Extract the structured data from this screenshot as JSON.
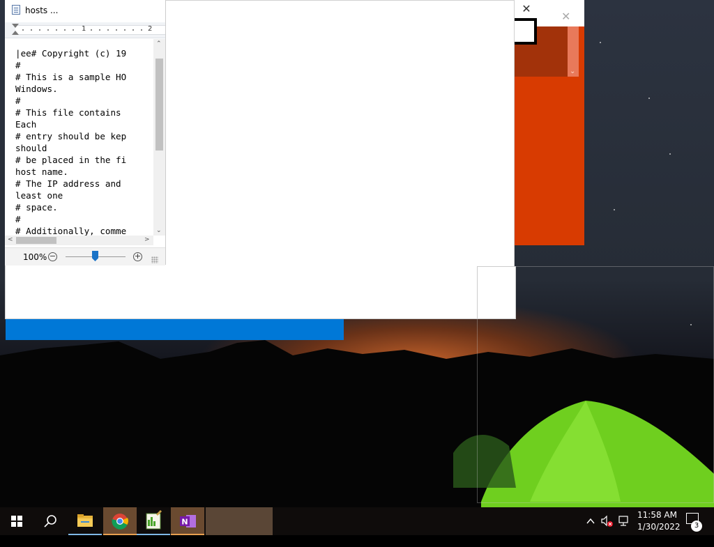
{
  "wordpad": {
    "title": "hosts ...",
    "ruler_marks": [
      "1",
      "2"
    ],
    "document_lines": [
      "|ee# Copyright (c) 19",
      "#",
      "# This is a sample HO",
      "Windows.",
      "#",
      "# This file contains",
      "Each",
      "# entry should be kep",
      "should",
      "# be placed in the fi",
      "host name.",
      "# The IP address and",
      "least one",
      "# space.",
      "#",
      "# Additionally, comme"
    ],
    "zoom_label": "100%",
    "zoom_out_symbol": "−",
    "zoom_in_symbol": "+",
    "zoom_percent": 100
  },
  "windows": {
    "close_symbol": "✕"
  },
  "taskbar": {
    "items": [
      {
        "name": "start-button",
        "icon": "windows-logo-icon"
      },
      {
        "name": "search-button",
        "icon": "search-icon"
      },
      {
        "name": "file-explorer",
        "icon": "folder-icon"
      },
      {
        "name": "google-chrome",
        "icon": "chrome-icon"
      },
      {
        "name": "notepad-plus",
        "icon": "notepad-icon"
      },
      {
        "name": "onenote",
        "icon": "onenote-icon",
        "letter": "N"
      },
      {
        "name": "task-window-1",
        "icon": ""
      },
      {
        "name": "task-window-2",
        "icon": ""
      }
    ],
    "tray": {
      "chevron": "^",
      "time": "11:58 AM",
      "date": "1/30/2022",
      "notification_count": "3"
    }
  },
  "colors": {
    "accent_blue": "#0078d7",
    "office_orange": "#d83b01",
    "onenote_purple": "#7719aa"
  }
}
